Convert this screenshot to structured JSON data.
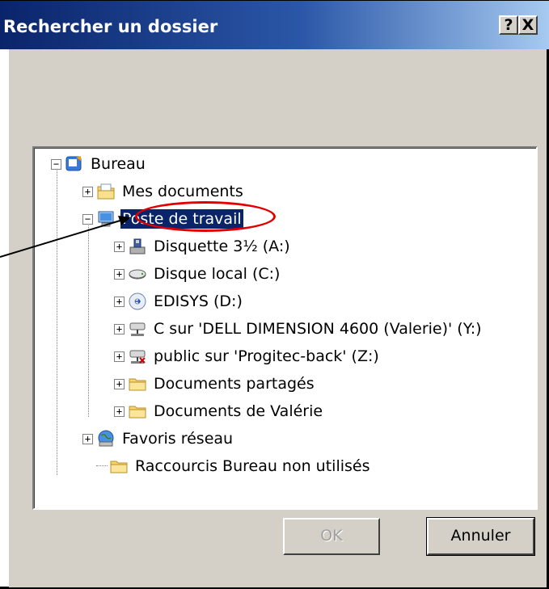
{
  "dialog": {
    "title": "Rechercher un dossier",
    "help_button": "?",
    "close_button": "X"
  },
  "tree": {
    "items": [
      {
        "label": "Bureau",
        "icon": "desktop-icon",
        "expander": "−"
      },
      {
        "label": "Mes documents",
        "icon": "my-documents-icon",
        "expander": "+"
      },
      {
        "label": "Poste de travail",
        "icon": "my-computer-icon",
        "expander": "−",
        "selected": true
      },
      {
        "label": "Disquette 3½ (A:)",
        "icon": "floppy-drive-icon",
        "expander": "+"
      },
      {
        "label": "Disque local (C:)",
        "icon": "hard-drive-icon",
        "expander": "+"
      },
      {
        "label": "EDISYS (D:)",
        "icon": "cd-drive-icon",
        "expander": "+"
      },
      {
        "label": "C sur 'DELL DIMENSION 4600 (Valerie)' (Y:)",
        "icon": "network-drive-icon",
        "expander": "+"
      },
      {
        "label": "public sur 'Progitec-back' (Z:)",
        "icon": "network-drive-icon",
        "expander": "+"
      },
      {
        "label": "Documents partagés",
        "icon": "folder-icon",
        "expander": "+"
      },
      {
        "label": "Documents de Valérie",
        "icon": "folder-icon",
        "expander": "+"
      },
      {
        "label": "Favoris réseau",
        "icon": "network-places-icon",
        "expander": "+"
      },
      {
        "label": "Raccourcis Bureau non utilisés",
        "icon": "folder-icon",
        "expander": ""
      }
    ]
  },
  "buttons": {
    "ok": "OK",
    "cancel": "Annuler"
  },
  "colors": {
    "titlebar_start": "#0a246a",
    "titlebar_end": "#a6caf0",
    "dialog_face": "#d4d0c8",
    "selection": "#0a246a",
    "annotation_ellipse": "#e00000"
  }
}
